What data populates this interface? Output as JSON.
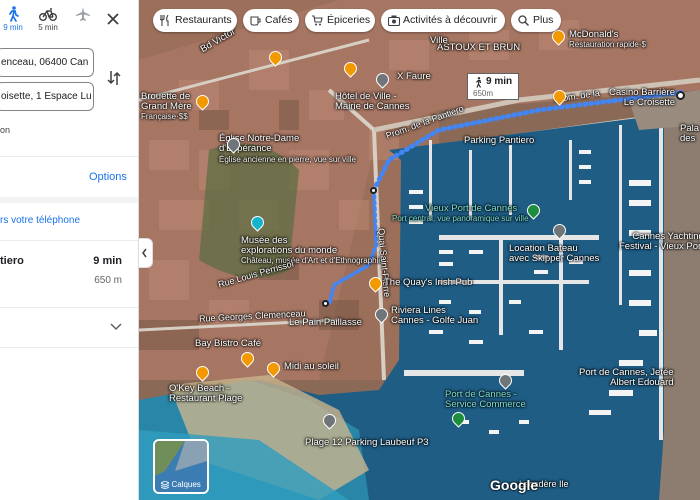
{
  "colors": {
    "accent": "#1a73e8",
    "route": "#4285f4",
    "sea": "#1f5d85",
    "restaurant_pin": "#f29900"
  },
  "panel": {
    "modes": [
      {
        "label": "9 min",
        "icon": "walk-icon",
        "selected": true
      },
      {
        "label": "5 min",
        "icon": "bike-icon",
        "selected": false
      },
      {
        "label": "",
        "icon": "flight-icon",
        "selected": false
      }
    ],
    "start_value": "enceau, 06400 Can",
    "destination_value": "oisette, 1 Espace Lu",
    "depart_text": "on",
    "options_label": "Options",
    "send_label": "rs votre téléphone",
    "route": {
      "name": "tiero",
      "time": "9 min",
      "distance": "650 m"
    }
  },
  "chips": [
    {
      "label": "Restaurants",
      "icon": "fork-knife-icon"
    },
    {
      "label": "Cafés",
      "icon": "coffee-icon"
    },
    {
      "label": "Épiceries",
      "icon": "cart-icon"
    },
    {
      "label": "Activités à découvrir",
      "icon": "camera-icon"
    },
    {
      "label": "Plus",
      "icon": "search-icon"
    }
  ],
  "walk_box": {
    "time": "9 min",
    "distance": "650m"
  },
  "map_labels": {
    "brouette": "Brouette de\nGrand Mère",
    "brouette_sub": "Française·$$",
    "hotel_ville": "Hôtel de Ville -\nMairie de Cannes",
    "astoux": "ASTOUX ET BRUN",
    "mcdonalds": "McDonald's",
    "mcdonalds_sub": "Restauration rapide·$",
    "casino": "Casino Barrière\nLe Croisette",
    "eglise": "Église Notre-Dame\nd'Espérance",
    "eglise_sub": "Église ancienne en pierre, vue sur ville",
    "parking_pantiero": "Parking Pantiero",
    "vieux_port": "Vieux Port de Cannes",
    "vieux_port_sub": "Port central, vue panoramique sur ville",
    "musee": "Musée des\nexplorations du monde",
    "musee_sub": "Château, musée d'Art et d'Ethnographie",
    "location_bateau": "Location Bateau\navec Skipper Cannes",
    "yachting": "Cannes Yachting\nFestival - Vieux Port",
    "quays": "The Quay's Irish Pub",
    "riviera": "Riviera Lines\nCannes - Golfe Juan",
    "pain_paillasse": "Le Pain Paillasse",
    "bay_bistro": "Bay Bistro Café",
    "midi": "Midi au soleil",
    "okey": "O'Key Beach -\nRestaurant Plage",
    "port_jetee": "Port de Cannes, Jetée\nAlbert Edouard",
    "port_service": "Port de Cannes -\nService Commerce",
    "plage12": "Plage 12 Parking Laubeuf P3",
    "rue_georges": "Rue Georges Clemenceau",
    "rue_louis": "Rue Louis Perrissol",
    "prom": "Prom. de la Pantiero",
    "prom2": "Prom. de la",
    "quai": "Quai Saint-Pierre",
    "faure": "X Faure",
    "palais": "Pala\ndes",
    "bd_victor": "Bd Victor",
    "ville": "Ville",
    "lecadere": "Lecadère Ile"
  },
  "layers_label": "Calques",
  "google_label": "Google"
}
